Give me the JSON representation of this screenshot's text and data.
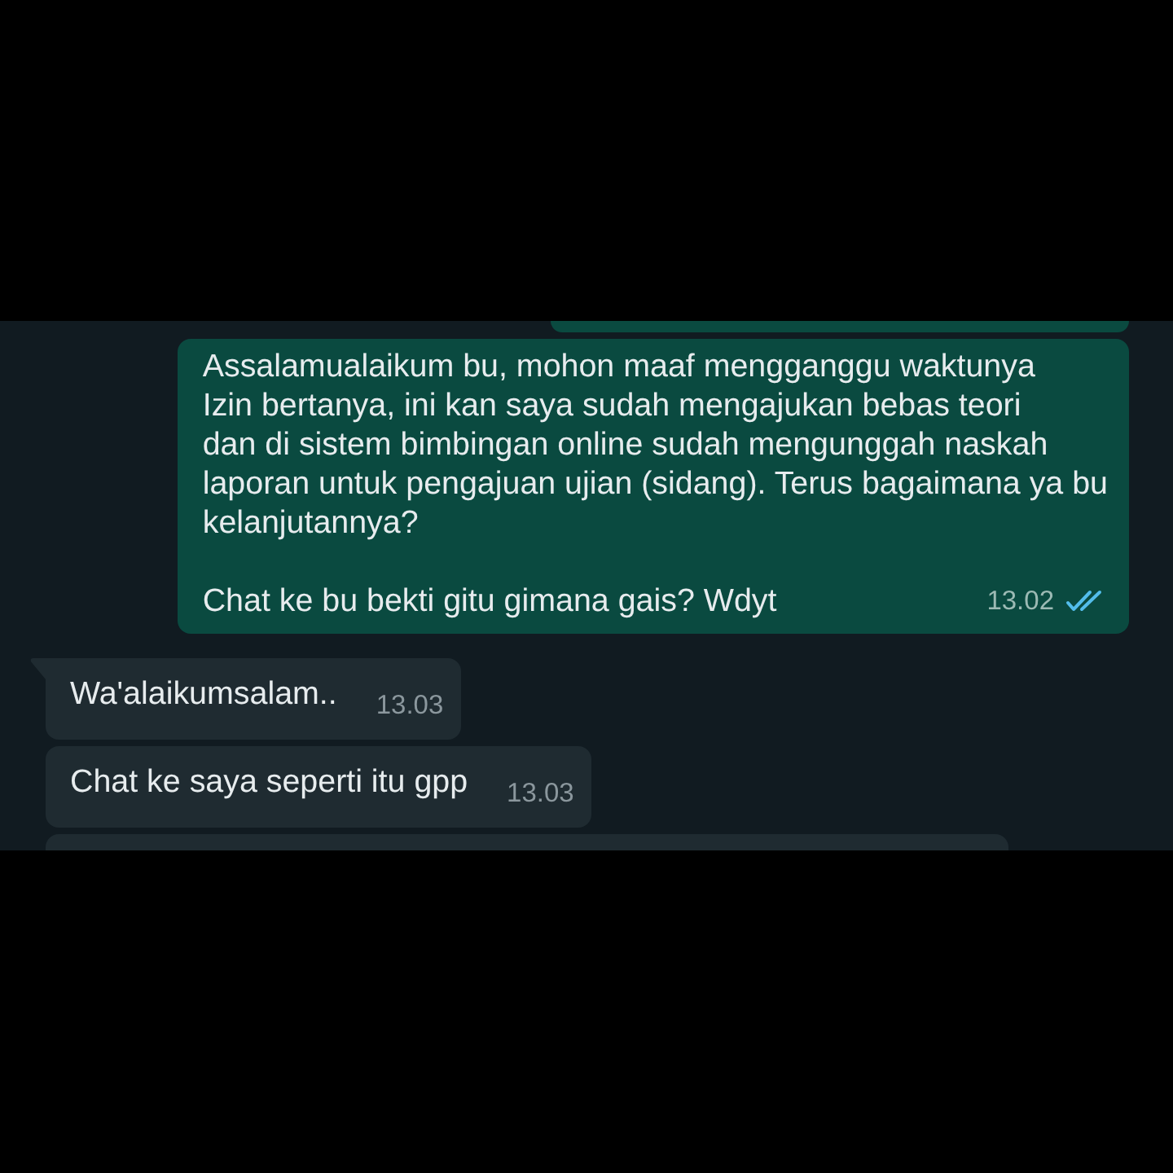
{
  "chat": {
    "messages": [
      {
        "kind": "outgoing",
        "clipped": true
      },
      {
        "kind": "outgoing",
        "clipped": false,
        "paragraphs": [
          "Assalamualaikum bu, mohon maaf mengganggu waktunya\nIzin bertanya, ini kan saya sudah mengajukan bebas teori\ndan di sistem bimbingan online sudah mengunggah naskah\nlaporan untuk pengajuan ujian (sidang). Terus bagaimana ya bu\nkelanjutannya?",
          "Chat ke bu bekti gitu gimana gais? Wdyt"
        ],
        "time": "13.02",
        "read": true
      },
      {
        "kind": "incoming",
        "clipped": false,
        "paragraphs": [
          "Wa'alaikumsalam.."
        ],
        "time": "13.03"
      },
      {
        "kind": "incoming",
        "clipped": false,
        "paragraphs": [
          "Chat ke saya seperti itu gpp"
        ],
        "time": "13.03"
      },
      {
        "kind": "incoming",
        "clipped": true
      }
    ]
  }
}
